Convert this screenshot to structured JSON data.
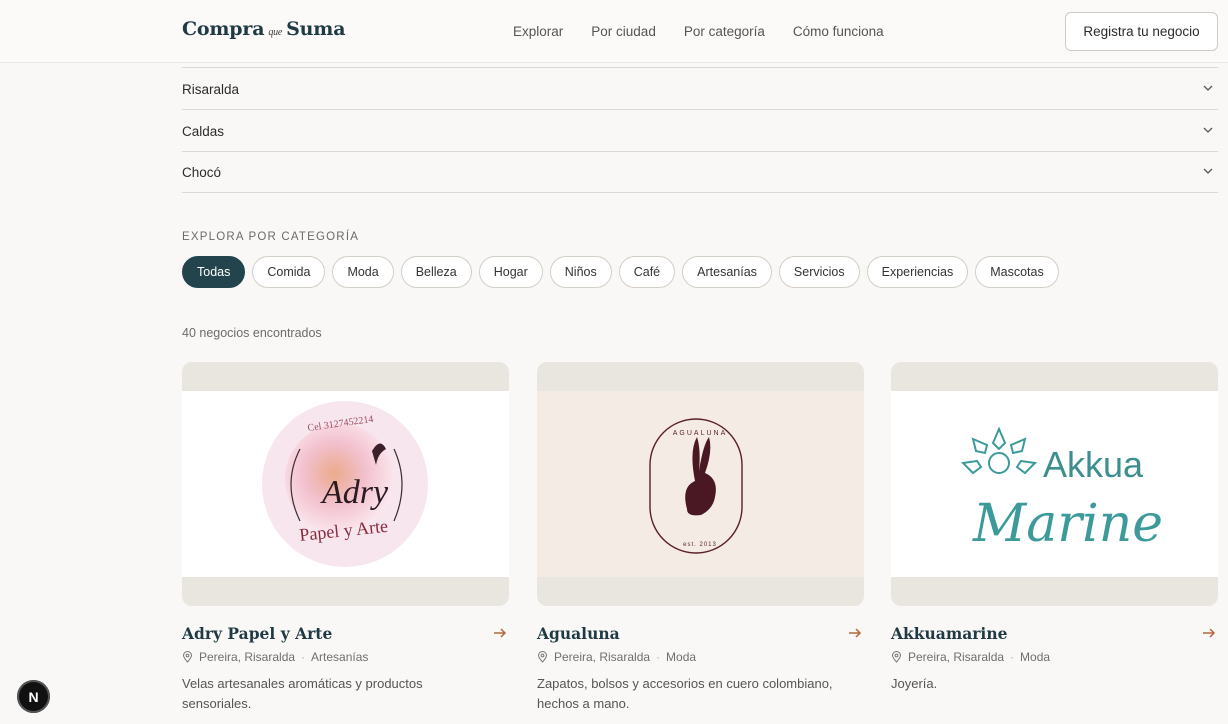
{
  "header": {
    "logo": {
      "part1": "Compra",
      "part2": "que",
      "part3": "Suma"
    },
    "nav": [
      "Explorar",
      "Por ciudad",
      "Por categoría",
      "Cómo funciona"
    ],
    "cta": "Registra tu negocio"
  },
  "regions": [
    "Risaralda",
    "Caldas",
    "Chocó"
  ],
  "categories": {
    "title": "EXPLORA POR CATEGORÍA",
    "chips": [
      "Todas",
      "Comida",
      "Moda",
      "Belleza",
      "Hogar",
      "Niños",
      "Café",
      "Artesanías",
      "Servicios",
      "Experiencias",
      "Mascotas"
    ],
    "active": "Todas"
  },
  "results_count": "40 negocios encontrados",
  "businesses": [
    {
      "name": "Adry Papel y Arte",
      "location": "Pereira, Risaralda",
      "category": "Artesanías",
      "description": "Velas artesanales aromáticas y productos sensoriales.",
      "logo_text": {
        "phone": "Cel 3127452214",
        "main": "Adry",
        "sub": "Papel y Arte"
      }
    },
    {
      "name": "Agualuna",
      "location": "Pereira, Risaralda",
      "category": "Moda",
      "description": "Zapatos, bolsos y accesorios en cuero colombiano, hechos a mano.",
      "logo_text": {
        "top": "AGUALUNA",
        "bottom": "est. 2013"
      }
    },
    {
      "name": "Akkuamarine",
      "location": "Pereira, Risaralda",
      "category": "Moda",
      "description": "Joyería.",
      "logo_text": {
        "top": "Akkua",
        "main": "Marine"
      }
    }
  ],
  "colors": {
    "brand": "#23444c",
    "accent": "#b5683f",
    "background": "#faf8f6"
  },
  "badge": "N"
}
